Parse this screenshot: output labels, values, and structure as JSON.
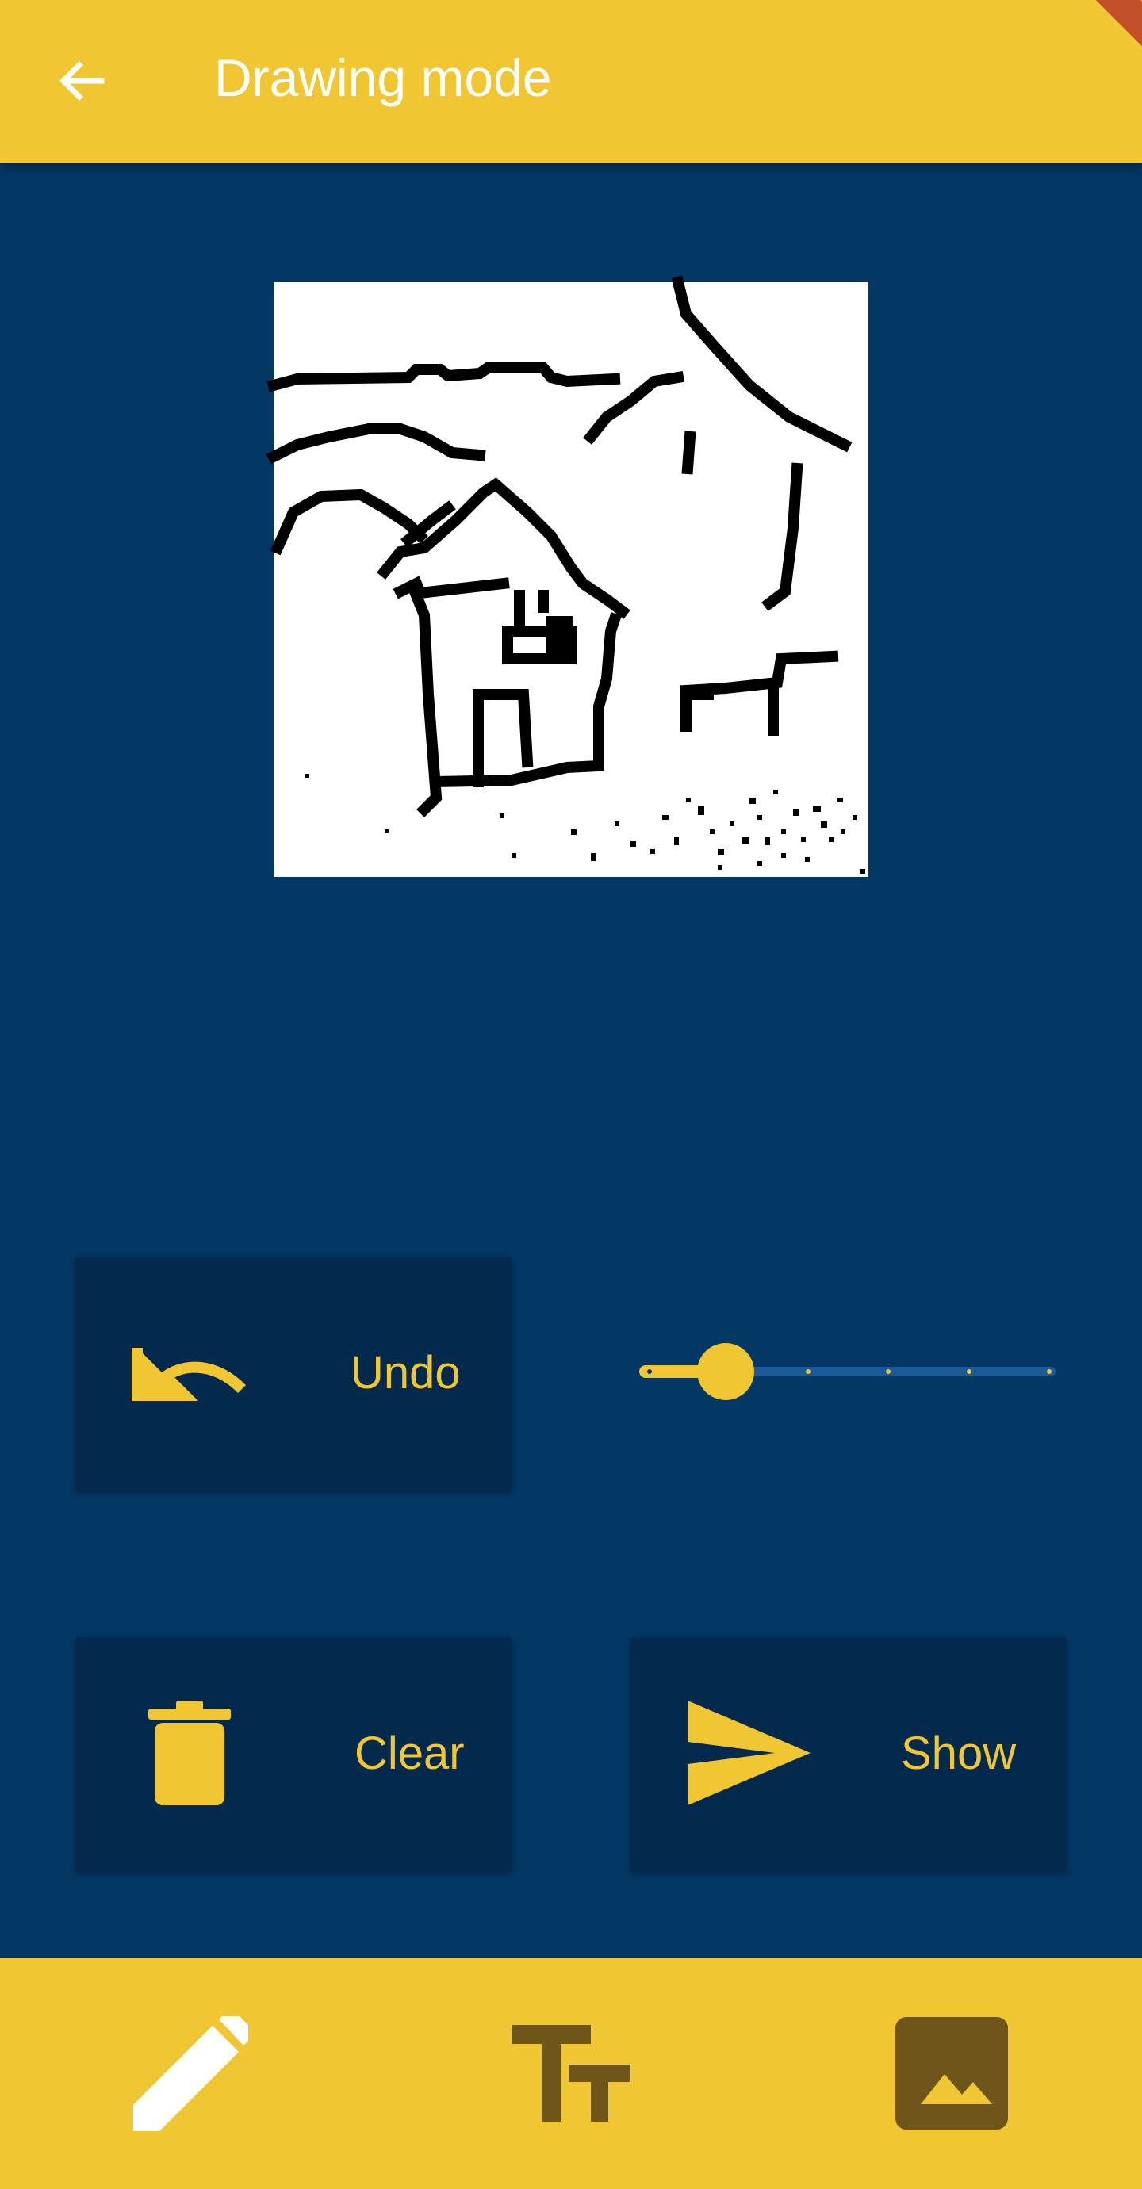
{
  "appbar": {
    "title": "Drawing mode",
    "back_icon": "arrow-back-icon"
  },
  "colors": {
    "primary": "#F0C633",
    "background": "#033764",
    "card": "#03294D",
    "nav_inactive": "#6E561B"
  },
  "controls": {
    "undo_label": "Undo",
    "undo_icon": "undo-icon",
    "clear_label": "Clear",
    "clear_icon": "trash-icon",
    "show_label": "Show",
    "show_icon": "send-icon",
    "stroke_slider": {
      "value": 2,
      "min": 1,
      "max": 6,
      "divisions": 5
    }
  },
  "bottom_nav": [
    {
      "icon": "pencil-icon",
      "active": true
    },
    {
      "icon": "text-size-icon",
      "active": false
    },
    {
      "icon": "image-icon",
      "active": false
    }
  ]
}
